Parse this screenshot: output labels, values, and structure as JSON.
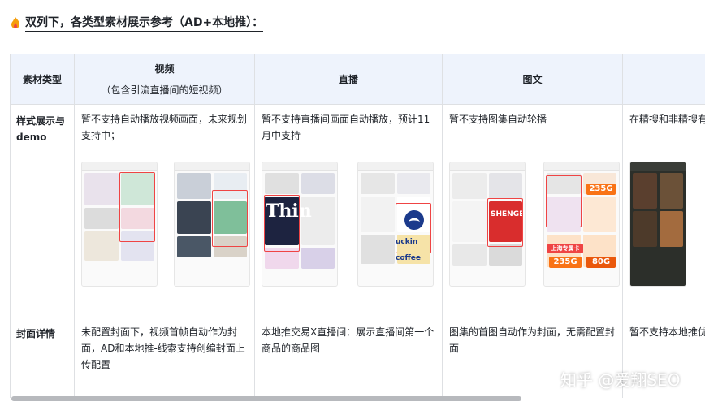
{
  "heading": {
    "text": "双列下，各类型素材展示参考（AD+本地推）："
  },
  "table": {
    "headers": {
      "type": "素材类型",
      "video": "视频",
      "video_sub": "（包含引流直播间的短视频）",
      "live": "直播",
      "image": "图文",
      "extra": ""
    },
    "rows": {
      "demo": {
        "label": "样式展示与demo",
        "video": "暂不支持自动播放视频画面，未来规划支持中；",
        "live": "暂不支持直播间画面自动播放，预计11月中支持",
        "image": "暂不支持图集自动轮播",
        "extra": "在精搜和非精搜有差异，如下"
      },
      "cover": {
        "label": "封面详情",
        "video": "未配置封面下，视频首帧自动作为封面，AD和本地推-线索支持创编封面上传配置",
        "live": "本地推交易X直播间：展示直播间第一个商品的商品图",
        "image": "图集的首图自动作为封面，无需配置封面",
        "extra": "暂不支持本地推优先在来客-下增加图片素材的封面"
      }
    },
    "screenshots": {
      "live_text": "Thin",
      "brand_text": "uckin coffee",
      "image_brand": "SHENGE",
      "promo_price": "235G",
      "promo_price_alt": "80G",
      "promo_city": "上海专属卡"
    }
  },
  "brandmark": {
    "text": "知乎 @爱翔SEO"
  },
  "colors": {
    "header_bg": "#eef3fc",
    "border": "#dee0e3",
    "highlight": "#ef4444",
    "accent": "#f97316"
  }
}
